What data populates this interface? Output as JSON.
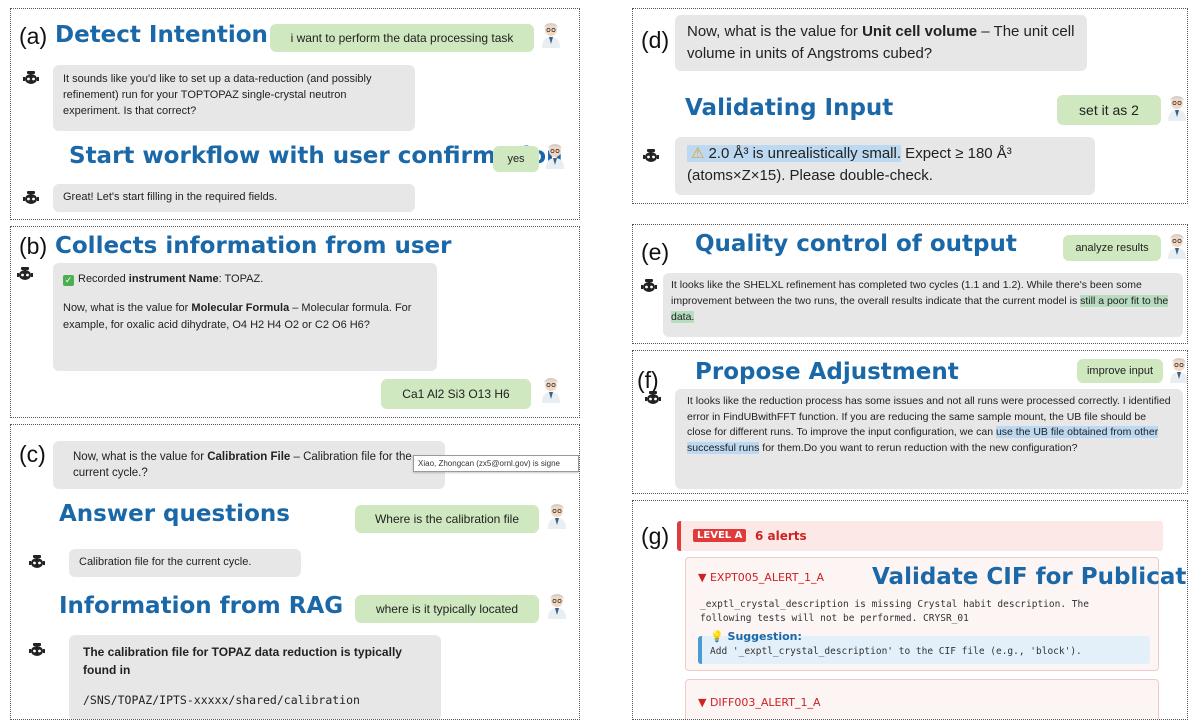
{
  "panel_a": {
    "label": "(a)",
    "title1": "Detect Intention",
    "user1": "i want to perform the data processing task",
    "bot1": "It sounds like you'd like to set up a data-reduction (and possibly refinement) run for your TOPTOPAZ single-crystal neutron experiment. Is that correct?",
    "title2": "Start workflow with user confirmation",
    "user2": "yes",
    "bot2": "Great! Let's start filling in the required fields."
  },
  "panel_b": {
    "label": "(b)",
    "title": "Collects information from user",
    "check_prefix": "Recorded ",
    "check_bold": "instrument Name",
    "check_suffix": ": TOPAZ.",
    "q_prefix": "Now, what is the value for ",
    "q_bold": "Molecular Formula",
    "q_suffix": " – Molecular formula. For example, for oxalic acid dihydrate, O4 H2 H4 O2 or C2 O6 H6?",
    "user": "Ca1 Al2 Si3 O13 H6"
  },
  "panel_c": {
    "label": "(c)",
    "q_prefix": "Now, what is the value for ",
    "q_bold": "Calibration File",
    "q_suffix": " – Calibration file for the current cycle.?",
    "tooltip": "Xiao, Zhongcan (zx5@ornl.gov) is signe",
    "title1": "Answer questions",
    "user1": "Where is the calibration file",
    "bot1": "Calibration file for the current cycle.",
    "title2": "Information from RAG",
    "user2": "where is it typically located",
    "bot2_bold": "The calibration file for TOPAZ data reduction is typically found in",
    "bot2_path": "/SNS/TOPAZ/IPTS-xxxxx/shared/calibration"
  },
  "panel_d": {
    "label": "(d)",
    "q_prefix": "Now, what is the value for ",
    "q_bold": "Unit cell volume",
    "q_suffix": " – The unit cell volume in units of Angstroms cubed?",
    "title": "Validating Input",
    "user": "set it as 2",
    "warn_icon": "⚠",
    "warn_hl": "2.0 Å³ is unrealistically small.",
    "warn_rest1": " Expect ≥ 180 Å³",
    "warn_rest2": "(atoms×Z×15). Please double-check."
  },
  "panel_e": {
    "label": "(e)",
    "title": "Quality control of output",
    "user": "analyze results",
    "bot_pre": "It looks like the SHELXL refinement has completed two cycles (1.1 and 1.2). While there's been some improvement between the two runs, the overall results indicate that the current model is ",
    "bot_hl": "still a poor fit to the data."
  },
  "panel_f": {
    "label": "(f)",
    "title": "Propose Adjustment",
    "user": "improve input",
    "bot_pre": "It looks like the reduction process has some issues and not all runs were processed correctly. I identified error in FindUBwithFFT function. If you are reducing the same sample mount, the UB file should be close for different runs. To improve the input configuration, we can ",
    "bot_hl": "use the UB file obtained from other successful runs",
    "bot_post": " for them.Do you want to rerun reduction with the new configuration?"
  },
  "panel_g": {
    "label": "(g)",
    "level": "LEVEL A",
    "count": "6 alerts",
    "title": "Validate CIF for Publication",
    "alert1_name": "▼ EXPT005_ALERT_1_A",
    "alert1_text1": "_exptl_crystal_description is missing Crystal habit description. The",
    "alert1_text2": "following tests will not be performed. CRYSR_01",
    "suggest_icon": "💡",
    "suggest_title": "Suggestion:",
    "suggest_text": "Add '_exptl_crystal_description' to the CIF file (e.g., 'block').",
    "alert2_name": "▼ DIFF003_ALERT_1_A"
  },
  "colors": {
    "title_blue": "#1a68a8",
    "user_green": "#cfe8c0",
    "bot_gray": "#e7e7e7",
    "highlight_blue": "#bcd9f1",
    "highlight_green": "#b7dcc0",
    "alert_red": "#e03a3a"
  },
  "icons": {
    "bot": "robot-icon",
    "user": "scientist-avatar-icon",
    "check": "check-icon"
  }
}
